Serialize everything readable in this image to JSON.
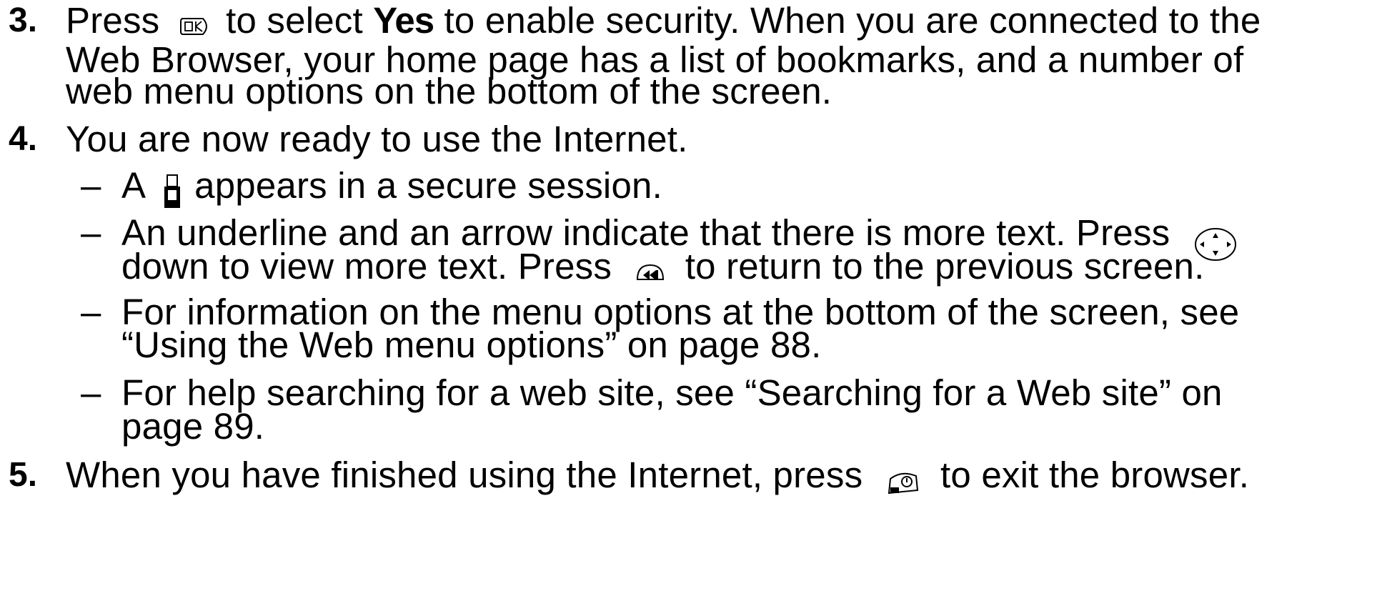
{
  "steps": [
    {
      "number": "3.",
      "lines": [
        {
          "prefix": "Press",
          "icon": "ok-key-icon",
          "middle": "to select",
          "bold": "Yes",
          "suffix": "to enable security. When you are connected to the"
        },
        {
          "text": "Web Browser, your home page has a list of bookmarks, and a number of"
        },
        {
          "text": "web menu options on the bottom of the screen."
        }
      ]
    },
    {
      "number": "4.",
      "lines": [
        {
          "text": "You are now ready to use the Internet."
        }
      ],
      "bullets": [
        {
          "dash": "–",
          "lines": [
            {
              "prefix": "A",
              "icon": "padlock-icon",
              "suffix": "appears in a secure session."
            }
          ]
        },
        {
          "dash": "–",
          "lines": [
            {
              "prefix": "An underline and an arrow indicate that there is more text. Press",
              "icon": "nav-key-icon"
            },
            {
              "prefix": "down to view more text. Press",
              "icon": "back-key-icon",
              "suffix": "to return to the previous screen."
            }
          ]
        },
        {
          "dash": "–",
          "lines": [
            {
              "text": "For information on the menu options at the bottom of the screen, see"
            },
            {
              "text": "“Using the Web menu options” on page 88."
            }
          ]
        },
        {
          "dash": "–",
          "lines": [
            {
              "text": "For help searching for a web site, see “Searching for a Web site” on"
            },
            {
              "text": "page 89."
            }
          ]
        }
      ]
    },
    {
      "number": "5.",
      "lines": [
        {
          "prefix": "When you have finished using the Internet, press",
          "icon": "end-key-icon",
          "suffix": "to exit the browser."
        }
      ]
    }
  ]
}
